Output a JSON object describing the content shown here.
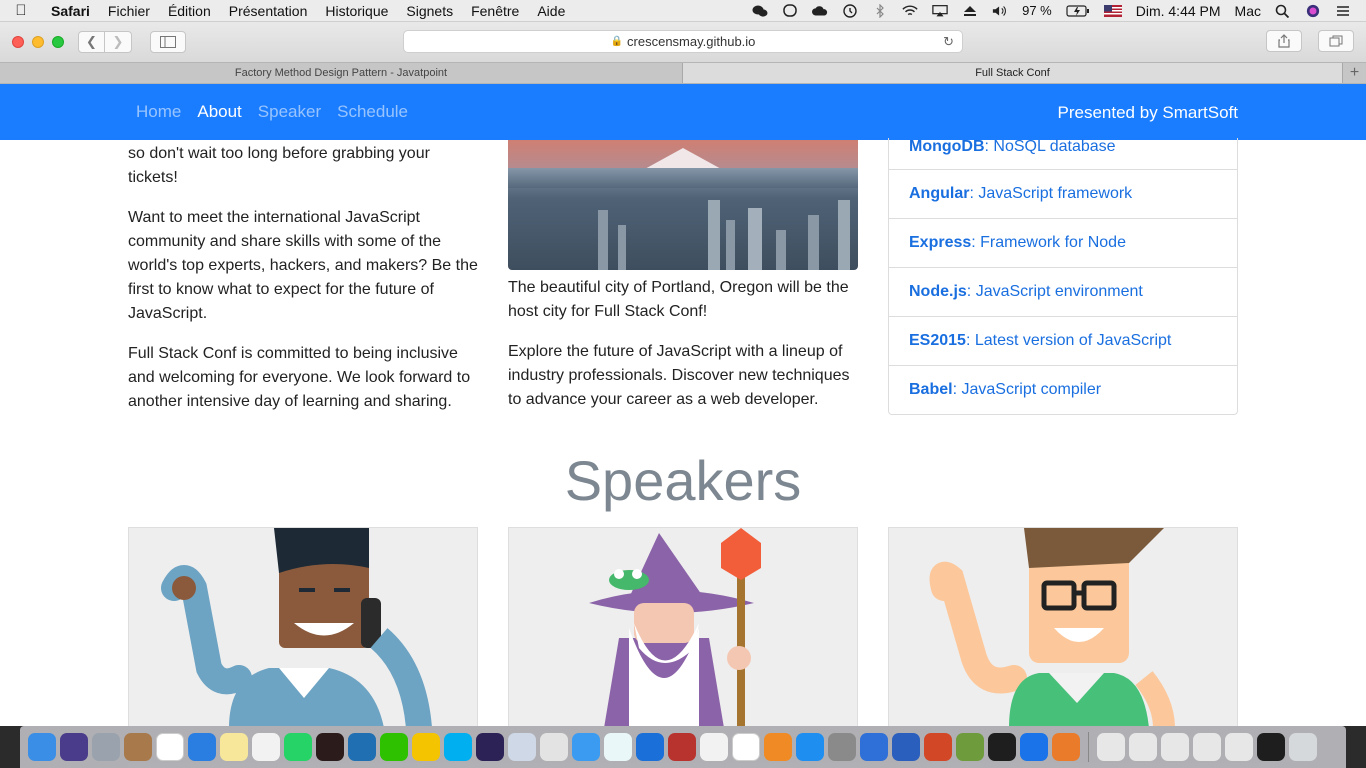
{
  "menubar": {
    "app": "Safari",
    "items": [
      "Fichier",
      "Édition",
      "Présentation",
      "Historique",
      "Signets",
      "Fenêtre",
      "Aide"
    ],
    "battery": "97 %",
    "clock": "Dim. 4:44 PM",
    "user": "Mac"
  },
  "browser": {
    "url": "crescensmay.github.io",
    "tabs": [
      "Factory Method Design Pattern - Javatpoint",
      "Full Stack Conf"
    ]
  },
  "site": {
    "nav": [
      "Home",
      "About",
      "Speaker",
      "Schedule"
    ],
    "active_nav": "About",
    "presented_by": "Presented by SmartSoft",
    "about_col1": {
      "p1": "so don't wait too long before grabbing your tickets!",
      "p2": "Want to meet the international JavaScript community and share skills with some of the world's top experts, hackers, and makers? Be the first to know what to expect for the future of JavaScript.",
      "p3": "Full Stack Conf is committed to being inclusive and welcoming for everyone. We look forward to another intensive day of learning and sharing."
    },
    "about_col2": {
      "caption": "The beautiful city of Portland, Oregon will be the host city for Full Stack Conf!",
      "p2": "Explore the future of JavaScript with a lineup of industry professionals. Discover new techniques to advance your career as a web developer."
    },
    "tech": [
      {
        "name": "MongoDB",
        "desc": ": NoSQL database"
      },
      {
        "name": "Angular",
        "desc": ": JavaScript framework"
      },
      {
        "name": "Express",
        "desc": ": Framework for Node"
      },
      {
        "name": "Node.js",
        "desc": ": JavaScript environment"
      },
      {
        "name": "ES2015",
        "desc": ": Latest version of JavaScript"
      },
      {
        "name": "Babel",
        "desc": ": JavaScript compiler"
      }
    ],
    "speakers_title": "Speakers"
  },
  "colors": {
    "brand": "#1a7cff",
    "link": "#1a6fe0"
  }
}
